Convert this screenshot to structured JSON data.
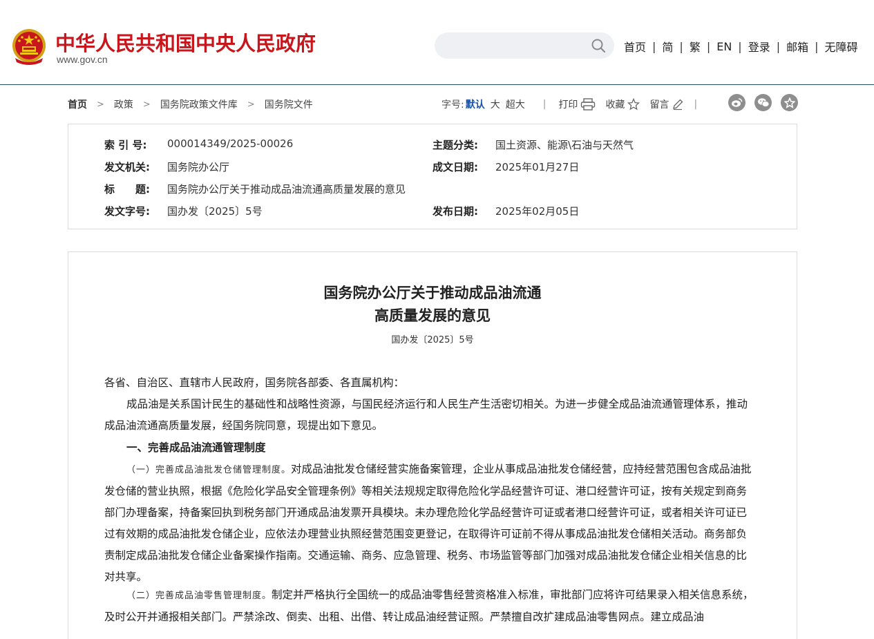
{
  "site": {
    "title": "中华人民共和国中央人民政府",
    "url": "www.gov.cn",
    "colors": {
      "brand_red": "#c8161d",
      "header_rule": "#2b4a66",
      "link_blue": "#1a52a8"
    }
  },
  "search": {
    "placeholder": "",
    "icon": "search-icon"
  },
  "topnav": [
    "首页",
    "简",
    "繁",
    "EN",
    "登录",
    "邮箱",
    "无障碍"
  ],
  "topnav_sep": "|",
  "breadcrumb": [
    "首页",
    "政策",
    "国务院政策文件库",
    "国务院文件"
  ],
  "breadcrumb_sep": ">",
  "toolbar": {
    "font_size_label": "字号:",
    "font_default": "默认",
    "font_large": "大",
    "font_xlarge": "超大",
    "sep": "|",
    "print": "打印",
    "favorite": "收藏",
    "comment": "留言",
    "share_icons": [
      "weibo-icon",
      "wechat-icon",
      "star-icon"
    ]
  },
  "info": {
    "index_label": "索 引 号:",
    "index_value": "000014349/2025-00026",
    "topic_label": "主题分类:",
    "topic_value": "国土资源、能源\\石油与天然气",
    "issuer_label": "发文机关:",
    "issuer_value": "国务院办公厅",
    "date_label": "成文日期:",
    "date_value": "2025年01月27日",
    "title_label": "标　　题:",
    "title_value": "国务院办公厅关于推动成品油流通高质量发展的意见",
    "docno_label": "发文字号:",
    "docno_value": "国办发〔2025〕5号",
    "pubdate_label": "发布日期:",
    "pubdate_value": "2025年02月05日"
  },
  "article": {
    "title_line1": "国务院办公厅关于推动成品油流通",
    "title_line2": "高质量发展的意见",
    "doc_no": "国办发〔2025〕5号",
    "salutation": "各省、自治区、直辖市人民政府，国务院各部委、各直属机构：",
    "intro": "成品油是关系国计民生的基础性和战略性资源，与国民经济运行和人民生产生活密切相关。为进一步健全成品油流通管理体系，推动成品油流通高质量发展，经国务院同意，现提出如下意见。",
    "section1": "一、完善成品油流通管理制度",
    "item1_head": "（一）完善成品油批发仓储管理制度。",
    "item1_body": "对成品油批发仓储经营实施备案管理，企业从事成品油批发仓储经营，应持经营范围包含成品油批发仓储的营业执照，根据《危险化学品安全管理条例》等相关法规规定取得危险化学品经营许可证、港口经营许可证，按有关规定到商务部门办理备案，持备案回执到税务部门开通成品油发票开具模块。未办理危险化学品经营许可证或者港口经营许可证，或者相关许可证已过有效期的成品油批发仓储企业，应依法办理营业执照经营范围变更登记，在取得许可证前不得从事成品油批发仓储相关活动。商务部负责制定成品油批发仓储企业备案操作指南。交通运输、商务、应急管理、税务、市场监管等部门加强对成品油批发仓储企业相关信息的比对共享。",
    "item2_head": "（二）完善成品油零售管理制度。",
    "item2_body": "制定并严格执行全国统一的成品油零售经营资格准入标准，审批部门应将许可结果录入相关信息系统，及时公开并通报相关部门。严禁涂改、倒卖、出租、出借、转让成品油经营证照。严禁擅自改扩建成品油零售网点。建立成品油"
  }
}
